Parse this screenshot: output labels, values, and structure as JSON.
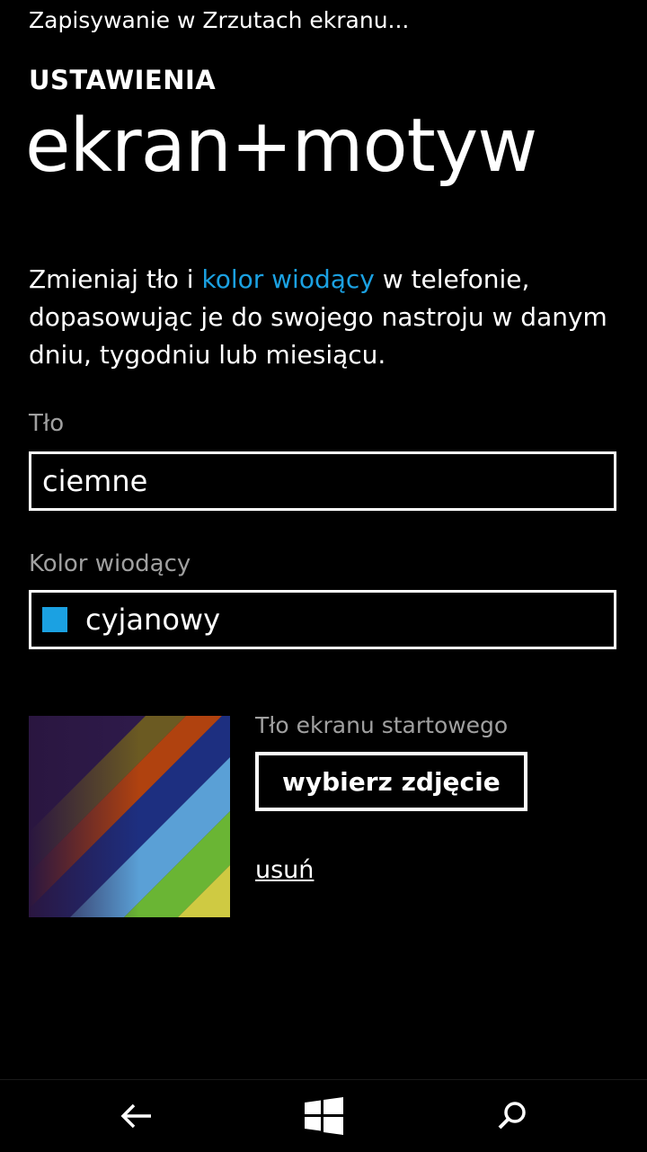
{
  "status_bar": {
    "text": "Zapisywanie w Zrzutach ekranu..."
  },
  "header": {
    "section": "USTAWIENIA",
    "title": "ekran+motyw"
  },
  "description": {
    "before_link": "Zmieniaj tło i ",
    "link": "kolor wiodący",
    "after_link": " w telefonie, dopasowując je do swojego nastroju w danym dniu, tygodniu lub miesiącu."
  },
  "background": {
    "label": "Tło",
    "value": "ciemne"
  },
  "accent_color": {
    "label": "Kolor wiodący",
    "value": "cyjanowy",
    "swatch_color": "#1ba1e2"
  },
  "start_background": {
    "label": "Tło ekranu startowego",
    "choose_button": "wybierz zdjęcie",
    "remove_link": "usuń"
  },
  "navbar": {
    "back_icon": "back-arrow-icon",
    "start_icon": "windows-logo-icon",
    "search_icon": "search-icon"
  }
}
